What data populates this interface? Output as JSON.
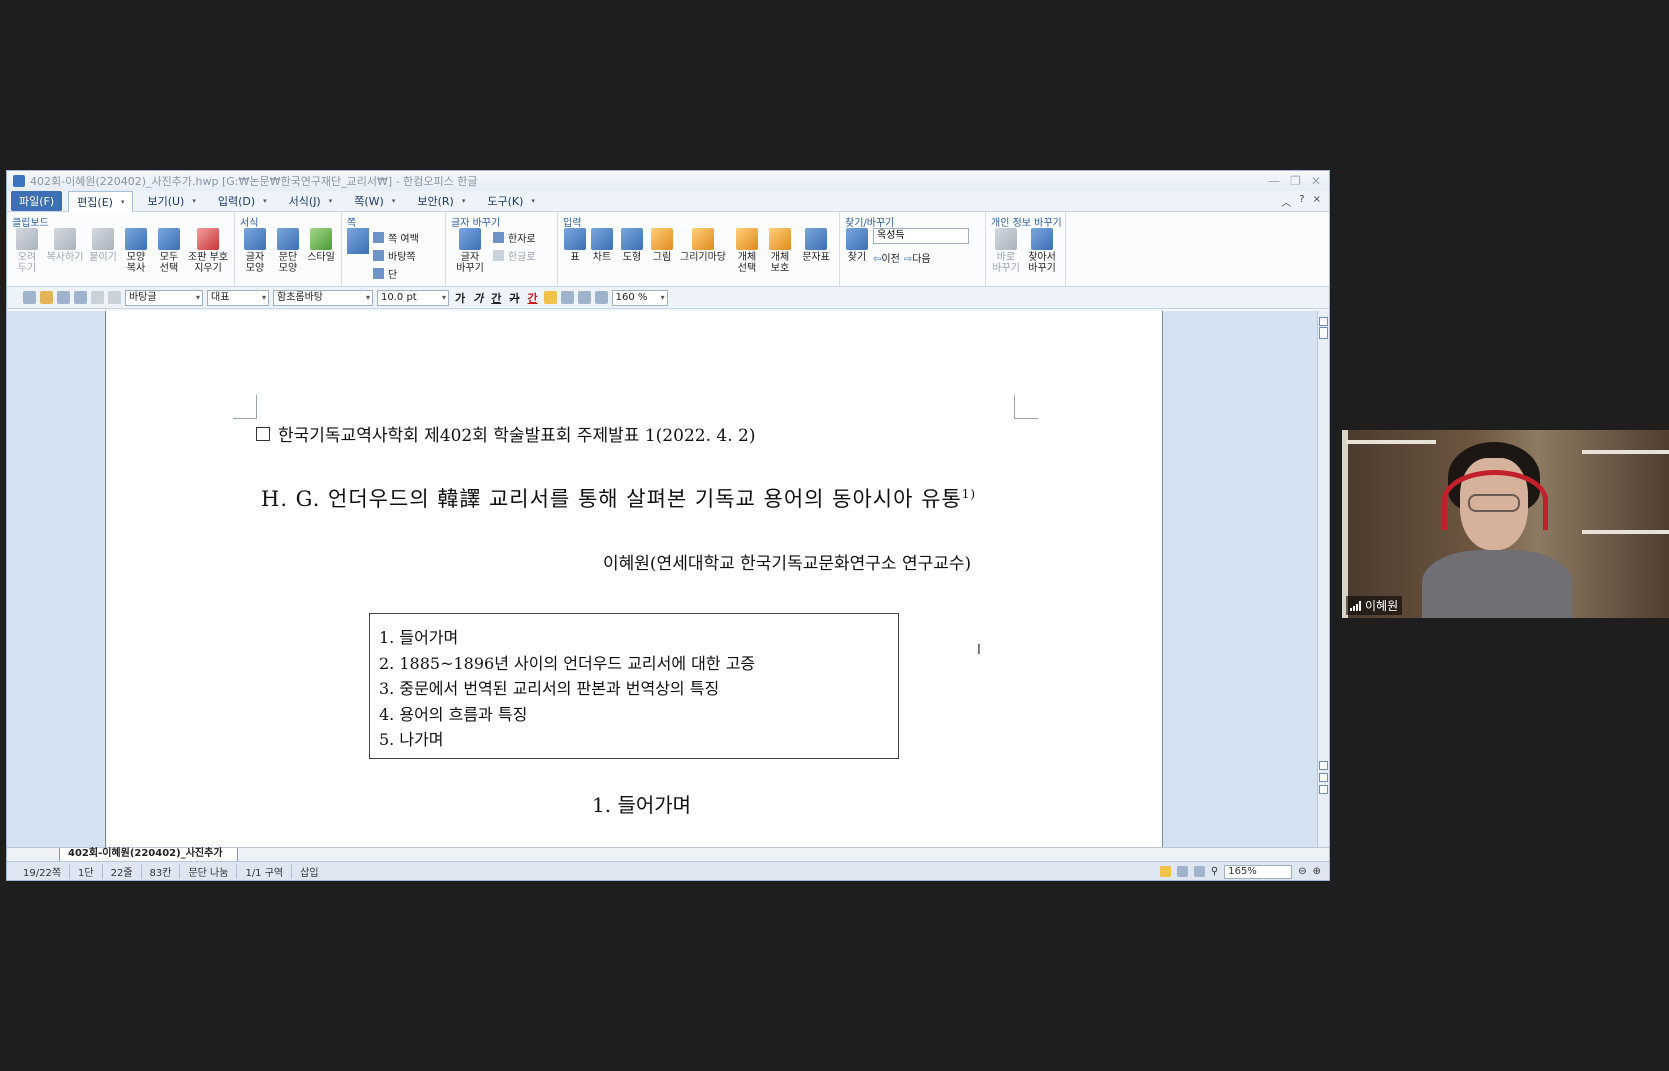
{
  "window": {
    "title": "402회-이혜원(220402)_사진추가.hwp [G:₩논문₩한국연구재단_교리서₩] - 한컴오피스 한글",
    "controls": {
      "minimize": "—",
      "restore": "❐",
      "close": "✕"
    }
  },
  "menubar": {
    "file": "파일(F)",
    "items": [
      "편집(E)",
      "보기(U)",
      "입력(D)",
      "서식(J)",
      "쪽(W)",
      "보안(R)",
      "도구(K)"
    ],
    "right": {
      "collapse": "︿",
      "help": "?",
      "close": "×"
    }
  },
  "ribbon": {
    "clipboard": {
      "title": "클립보드",
      "tools": [
        "오려\n두기",
        "복사하기",
        "붙이기",
        "모양\n복사",
        "모두\n선택",
        "조판 부호\n지우기"
      ]
    },
    "format": {
      "title": "서식",
      "tools": [
        "글자\n모양",
        "문단\n모양",
        "스타일"
      ]
    },
    "page": {
      "title": "쪽",
      "rows": [
        "쪽 여백",
        "바탕쪽",
        "단"
      ]
    },
    "convert": {
      "title": "글자 바꾸기",
      "rows": [
        "한자로",
        "한글로"
      ],
      "tool": "글자\n바꾸기"
    },
    "insert": {
      "title": "입력",
      "tools": [
        "표",
        "차트",
        "도형",
        "그림",
        "그리기마당",
        "개체\n선택",
        "개체\n보호",
        "문자표"
      ]
    },
    "find": {
      "title": "찾기/바꾸기",
      "tool": "찾기",
      "value": "옥성득",
      "prev": "이전",
      "next": "다음"
    },
    "privacy": {
      "title": "개인 정보 바꾸기",
      "tools": [
        "바로\n바꾸기",
        "찾아서\n바꾸기"
      ]
    }
  },
  "toolbar2": {
    "style": "바탕글",
    "lang": "대표",
    "font": "함초롬바탕",
    "size": "10.0",
    "unit": "pt",
    "bold": "가",
    "italic": "가",
    "underline": "간",
    "strike": "가",
    "color": "간",
    "linespacing": "160",
    "percent": "%"
  },
  "document": {
    "header": "한국기독교역사학회 제402회 학술발표회 주제발표 1(2022. 4. 2)",
    "title": "H. G. 언더우드의 韓譯 교리서를 통해 살펴본 기독교 용어의 동아시아 유통",
    "footnote": "1)",
    "author": "이혜원(연세대학교 한국기독교문화연구소 연구교수)",
    "toc": [
      "1. 들어가며",
      "2. 1885~1896년 사이의 언더우드 교리서에 대한 고증",
      "3. 중문에서 번역된 교리서의 판본과 번역상의 특징",
      "4. 용어의 흐름과 특징",
      "5. 나가며"
    ],
    "section": "1. 들어가며"
  },
  "tab": "402회-이혜원(220402)_사진추가",
  "status": {
    "page": "19/22쪽",
    "column": "1단",
    "line": "22줄",
    "col": "83칸",
    "break": "문단 나눔",
    "section": "1/1 구역",
    "mode": "삽입",
    "zoom": "165%"
  },
  "video": {
    "name": "이혜원"
  }
}
